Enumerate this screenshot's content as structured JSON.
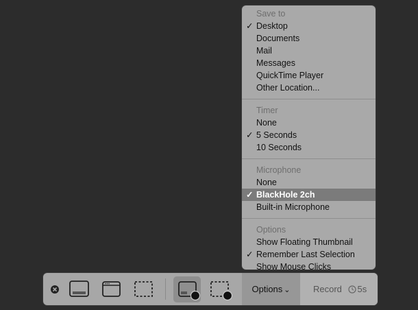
{
  "menu": {
    "sections": [
      {
        "header": "Save to",
        "items": [
          {
            "label": "Desktop",
            "checked": true
          },
          {
            "label": "Documents"
          },
          {
            "label": "Mail"
          },
          {
            "label": "Messages"
          },
          {
            "label": "QuickTime Player"
          },
          {
            "label": "Other Location..."
          }
        ]
      },
      {
        "header": "Timer",
        "items": [
          {
            "label": "None"
          },
          {
            "label": "5 Seconds",
            "checked": true
          },
          {
            "label": "10 Seconds"
          }
        ]
      },
      {
        "header": "Microphone",
        "items": [
          {
            "label": "None"
          },
          {
            "label": "BlackHole 2ch",
            "checked": true,
            "highlighted": true
          },
          {
            "label": "Built-in Microphone"
          }
        ]
      },
      {
        "header": "Options",
        "items": [
          {
            "label": "Show Floating Thumbnail"
          },
          {
            "label": "Remember Last Selection",
            "checked": true
          },
          {
            "label": "Show Mouse Clicks"
          }
        ]
      }
    ],
    "check_glyph": "✓"
  },
  "toolbar": {
    "options_label": "Options",
    "options_chevron": "⌄",
    "record_label": "Record",
    "timer_label": "5s"
  }
}
